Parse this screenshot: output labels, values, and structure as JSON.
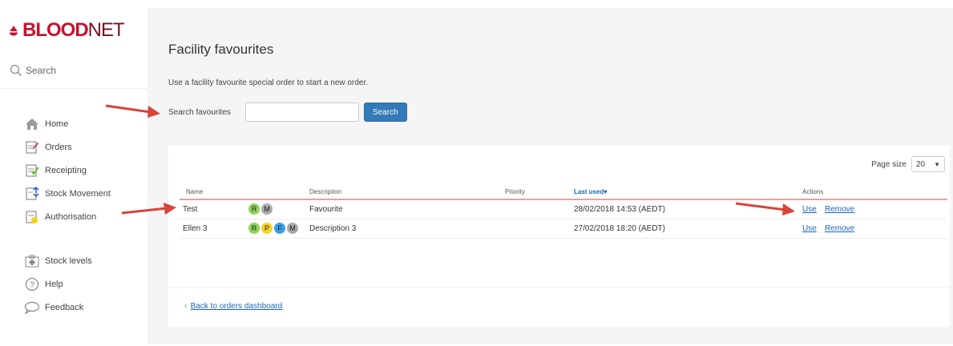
{
  "brand": {
    "logo_blood": "BLOOD",
    "logo_net": "NET",
    "brand_color": "#c8102e"
  },
  "sidebar": {
    "search_label": "Search",
    "nav": [
      {
        "label": "Home",
        "icon": "home-icon"
      },
      {
        "label": "Orders",
        "icon": "orders-icon"
      },
      {
        "label": "Receipting",
        "icon": "receipting-icon"
      },
      {
        "label": "Stock Movement",
        "icon": "stock-movement-icon"
      },
      {
        "label": "Authorisation",
        "icon": "authorisation-icon"
      }
    ],
    "nav2": [
      {
        "label": "Stock levels",
        "icon": "stock-levels-icon"
      },
      {
        "label": "Help",
        "icon": "help-icon"
      },
      {
        "label": "Feedback",
        "icon": "feedback-icon"
      }
    ]
  },
  "main": {
    "title": "Facility favourites",
    "subtitle": "Use a facility favourite special order to start a new order.",
    "search_label": "Search favourites",
    "search_value": "",
    "search_button": "Search",
    "page_size_label": "Page size",
    "page_size_value": "20",
    "columns": {
      "name": "Name",
      "description": "Description",
      "priority": "Priority",
      "last_used": "Last used",
      "actions": "Actions"
    },
    "rows": [
      {
        "name": "Test",
        "badges": [
          {
            "letter": "R",
            "color": "#8fd35a"
          },
          {
            "letter": "M",
            "color": "#aaaaaa"
          }
        ],
        "description": "Favourite",
        "priority": "",
        "last_used": "28/02/2018 14:53 (AEDT)",
        "use": "Use",
        "remove": "Remove"
      },
      {
        "name": "Ellen 3",
        "badges": [
          {
            "letter": "R",
            "color": "#8fd35a"
          },
          {
            "letter": "P",
            "color": "#f5d327"
          },
          {
            "letter": "F",
            "color": "#3aa0e6"
          },
          {
            "letter": "M",
            "color": "#aaaaaa"
          }
        ],
        "description": "Description 3",
        "priority": "",
        "last_used": "27/02/2018 18:20 (AEDT)",
        "use": "Use",
        "remove": "Remove"
      }
    ],
    "back_link": "Back to orders dashboard"
  },
  "annotation_color": "#d9443a"
}
